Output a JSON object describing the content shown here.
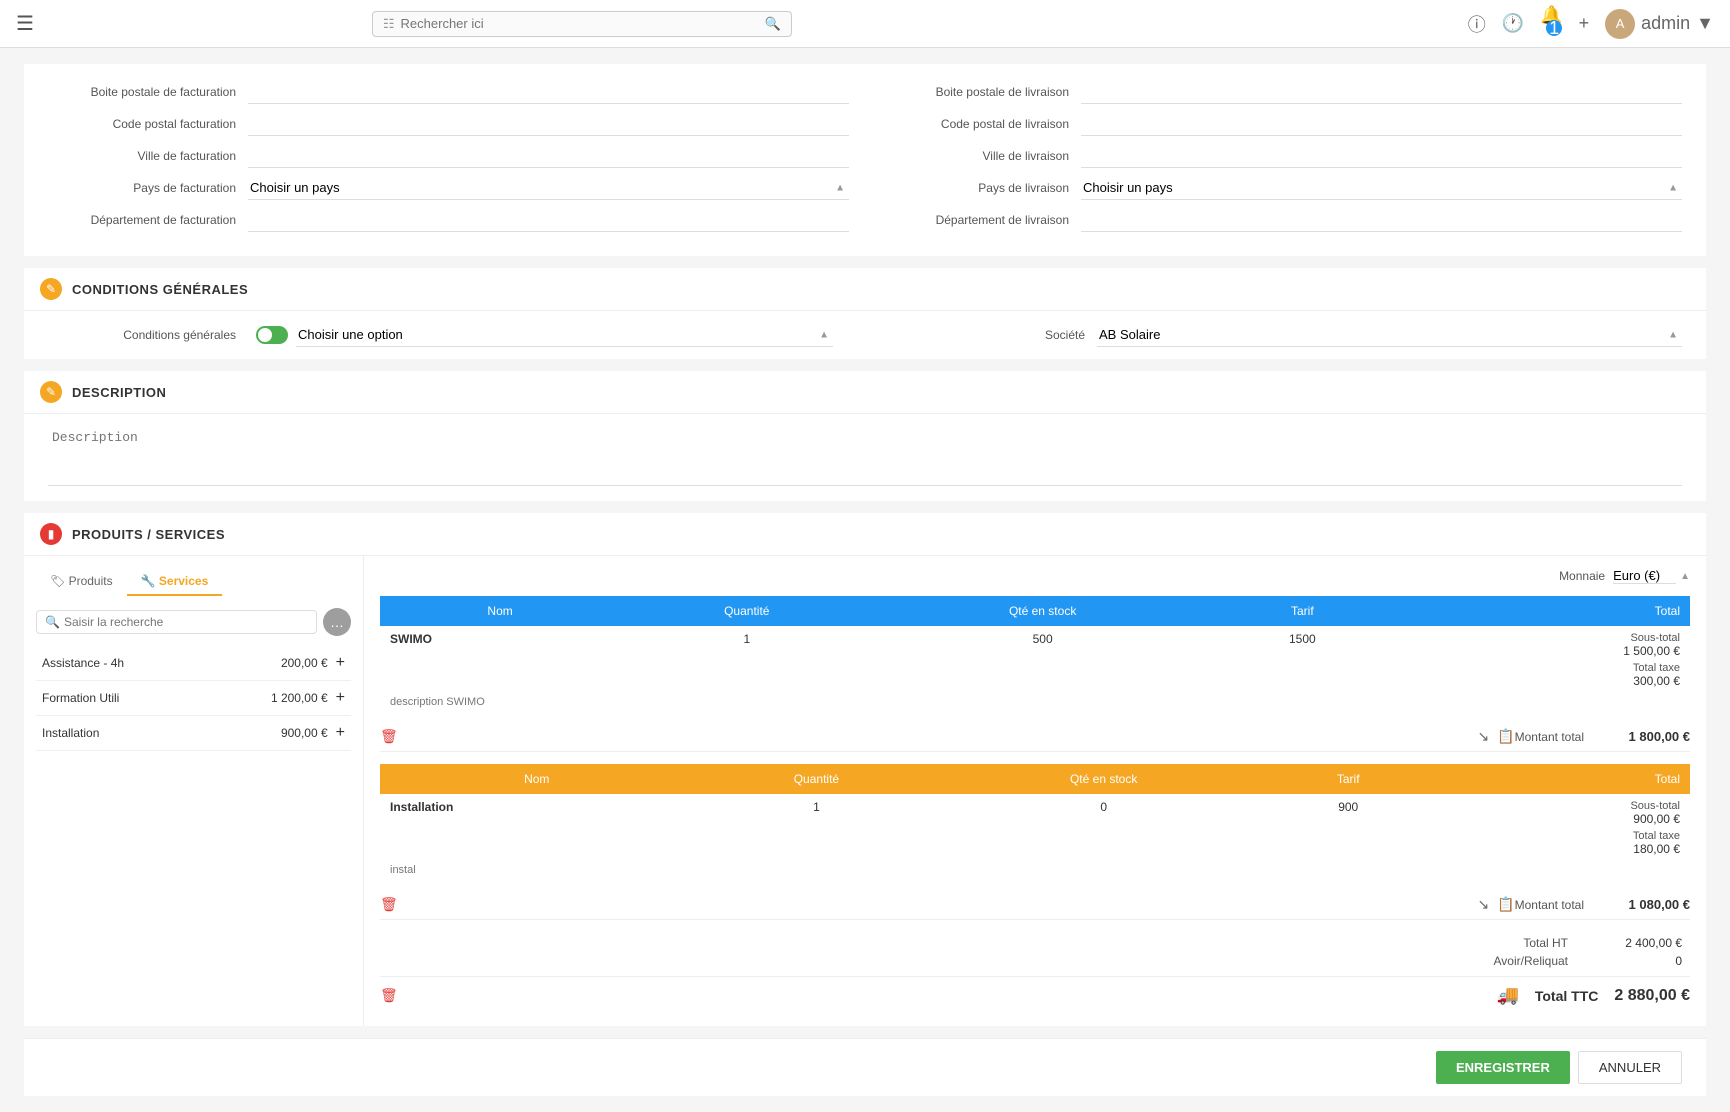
{
  "topnav": {
    "menu_icon": "☰",
    "search_placeholder": "Rechercher ici",
    "notification_count": "1",
    "user_label": "admin",
    "user_dropdown": "▼"
  },
  "billing_address": {
    "boite_postale_label": "Boite postale de facturation",
    "code_postal_label": "Code postal facturation",
    "ville_label": "Ville de facturation",
    "pays_label": "Pays de facturation",
    "pays_placeholder": "Choisir un pays",
    "departement_label": "Département de facturation"
  },
  "delivery_address": {
    "boite_postale_label": "Boite postale de livraison",
    "code_postal_label": "Code postal de livraison",
    "ville_label": "Ville de livraison",
    "pays_label": "Pays de livraison",
    "pays_placeholder": "Choisir un pays",
    "departement_label": "Département de livraison"
  },
  "conditions": {
    "section_title": "Conditions Générales",
    "conditions_label": "Conditions générales",
    "option_placeholder": "Choisir une option",
    "societe_label": "Société",
    "societe_value": "AB Solaire"
  },
  "description": {
    "section_title": "Description",
    "placeholder": "Description"
  },
  "products": {
    "section_title": "Produits / Services",
    "tab_produits": "Produits",
    "tab_services": "Services",
    "search_placeholder": "Saisir la recherche",
    "currency_label": "Monnaie",
    "currency_value": "Euro (€)",
    "services": [
      {
        "name": "Assistance - 4h",
        "price": "200,00 €"
      },
      {
        "name": "Formation Utili",
        "price": "1 200,00 €"
      },
      {
        "name": "Installation",
        "price": "900,00 €"
      }
    ],
    "table_blue": {
      "header": [
        "Nom",
        "Quantité",
        "Qté en stock",
        "Tarif",
        "Total"
      ],
      "row": {
        "name": "SWIMO",
        "description": "description SWIMO",
        "quantite": "1",
        "qte_stock": "500",
        "tarif": "1500",
        "sous_total_label": "Sous-total",
        "sous_total_value": "1 500,00 €",
        "total_taxe_label": "Total taxe",
        "total_taxe_value": "300,00 €"
      },
      "montant_label": "Montant total",
      "montant_value": "1 800,00 €"
    },
    "table_orange": {
      "header": [
        "Nom",
        "Quantité",
        "Qté en stock",
        "Tarif",
        "Total"
      ],
      "row": {
        "name": "Installation",
        "description": "instal",
        "quantite": "1",
        "qte_stock": "0",
        "tarif": "900",
        "sous_total_label": "Sous-total",
        "sous_total_value": "900,00 €",
        "total_taxe_label": "Total taxe",
        "total_taxe_value": "180,00 €"
      },
      "montant_label": "Montant total",
      "montant_value": "1 080,00 €"
    },
    "total_ht_label": "Total HT",
    "total_ht_value": "2 400,00 €",
    "avoir_label": "Avoir/Reliquat",
    "avoir_value": "0",
    "total_ttc_label": "Total TTC",
    "total_ttc_value": "2 880,00 €"
  },
  "buttons": {
    "enregistrer": "ENREGISTRER",
    "annuler": "ANNULER"
  }
}
